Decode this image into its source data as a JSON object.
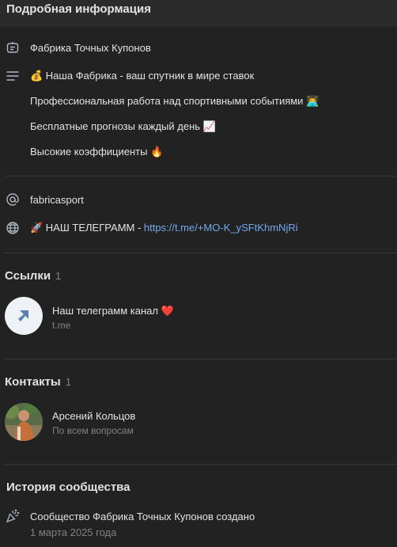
{
  "header": {
    "title": "Подробная информация"
  },
  "info": {
    "name": "Фабрика Точных Купонов",
    "description_lines": [
      "💰 Наша Фабрика - ваш спутник в мире ставок",
      "Профессиональная работа над спортивными событиями 👨‍💻",
      "Бесплатные прогнозы каждый день 📈",
      "Высокие коэффициенты 🔥"
    ],
    "address": "fabricasport",
    "site_prefix": "🚀 НАШ ТЕЛЕГРАММ - ",
    "site_link": "https://t.me/+MO-K_ySFtKhmNjRi"
  },
  "links_section": {
    "title": "Ссылки",
    "count": "1",
    "items": [
      {
        "title": "Наш телеграмм канал ❤️",
        "domain": "t.me"
      }
    ]
  },
  "contacts_section": {
    "title": "Контакты",
    "count": "1",
    "items": [
      {
        "name": "Арсений Кольцов",
        "role": "По всем вопросам"
      }
    ]
  },
  "history_section": {
    "title": "История сообщества",
    "event": "Сообщество Фабрика Точных Купонов создано",
    "date": "1 марта 2025 года"
  },
  "colors": {
    "background": "#222222",
    "header": "#2b2b2c",
    "text": "#e1e3e6",
    "secondary": "#828282",
    "link": "#71aaeb"
  }
}
